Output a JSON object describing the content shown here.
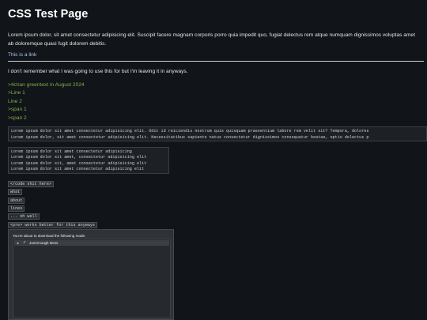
{
  "page": {
    "title": "CSS Test Page",
    "lorem": "Lorem ipsum dolor, sit amet consectetur adipisicing elit. Suscipit facere magnam corporis porro quia impedit quo, fugiat delectus rem atque numquam dignissimos voluptas amet ab doloremque quasi fugit dolorem debitis.",
    "link": "This is a link",
    "remember": "I don't remember what I was going to use this for but I'm leaving it in anyways."
  },
  "greentext": [
    ">4chan greentext in August 2024",
    ">Line 1",
    "Line 2",
    ">span 1",
    ">span 2"
  ],
  "codeblock_wide": [
    "Lorem ipsum dolor sit amet consectetur adipisicing elit. Odit id reiciendis nostrum quis quisquam praesentium labore rem velit sit? Tempora, dolores",
    "Lorem ipsum dolor, sit amet consectetur adipisicing elit. Necessitatibus sapiente natus consectetur dignissimos consequatur beatae, optio delectus p"
  ],
  "codeblock_narrow": [
    "Lorem ipsum dolor sit amet consectetur adipisicing",
    "Lorem ipsum dolor sit amet, consectetur adipisicing elit",
    "Lorem ipsum dolor sit, amet consectetur adipisicing elit",
    "Lorem ipsum dolor sit amet consectetur adipisicing elit"
  ],
  "inline_codes": [
    "</code shit here>",
    "what",
    "about",
    "lines",
    "... oh well",
    "<pre> works better for this anyways"
  ],
  "dialog": {
    "title": "You're about to download the following mods:",
    "items": [
      {
        "label": "Just Enough Items",
        "checked": true,
        "expanded": false
      }
    ],
    "arrow_glyph": "►",
    "check_glyph": "✓"
  }
}
